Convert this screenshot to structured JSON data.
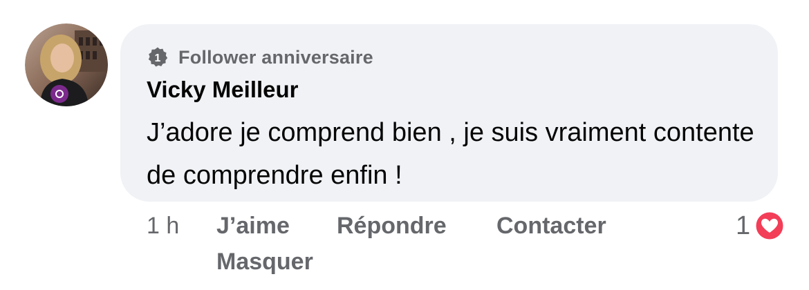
{
  "comment": {
    "badge": {
      "icon": "badge-number-icon",
      "number": "1",
      "label": "Follower anniversaire"
    },
    "author": "Vicky Meilleur",
    "text": "J’adore je comprend bien , je suis vraiment contente de comprendre enfin !",
    "actions": {
      "time": "1 h",
      "like": "J’aime",
      "reply": "Répondre",
      "contact": "Contacter",
      "hide": "Masquer"
    },
    "reactions": {
      "count": "1",
      "icon": "heart-reaction-icon"
    }
  },
  "colors": {
    "bubble": "#f0f2f5",
    "secondary_text": "#65676b",
    "primary_text": "#050505",
    "heart_red": "#f33e58",
    "avatar_badge": "#7b2a8c"
  }
}
